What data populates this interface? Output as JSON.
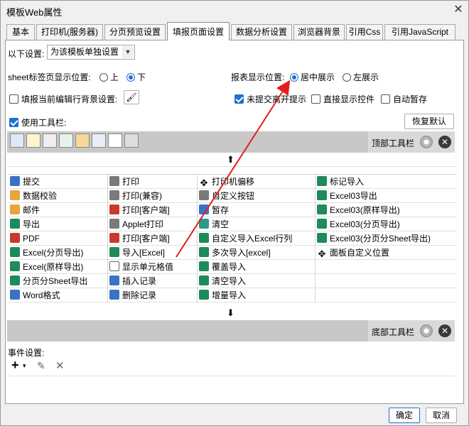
{
  "window": {
    "title": "模板Web属性",
    "close_glyph": "✕"
  },
  "tabs": [
    {
      "label": "基本"
    },
    {
      "label": "打印机(服务器)"
    },
    {
      "label": "分页预览设置"
    },
    {
      "label": "填报页面设置"
    },
    {
      "label": "数据分析设置"
    },
    {
      "label": "浏览器背景"
    },
    {
      "label": "引用Css"
    },
    {
      "label": "引用JavaScript"
    }
  ],
  "settings": {
    "scope_label": "以下设置:",
    "scope_value": "为该模板单独设置",
    "sheet_pos_label": "sheet标签页显示位置:",
    "sheet_pos_options": [
      "上",
      "下"
    ],
    "sheet_pos_selected": "下",
    "report_pos_label": "报表显示位置:",
    "report_pos_options": [
      "居中展示",
      "左展示"
    ],
    "report_pos_selected": "居中展示",
    "fill_bg_label": "填报当前编辑行背景设置:",
    "unsubmitted_label": "未提交离开提示",
    "direct_ctrl_label": "直接显示控件",
    "autosave_label": "自动暂存",
    "use_toolbar_label": "使用工具栏:",
    "restore_default": "恢复默认"
  },
  "top_toolbar": {
    "label": "顶部工具栏"
  },
  "bottom_toolbar": {
    "label": "底部工具栏"
  },
  "buttons_grid": {
    "col1": [
      {
        "label": "提交",
        "icon": "submit-icon"
      },
      {
        "label": "数据校验",
        "icon": "verify-icon"
      },
      {
        "label": "邮件",
        "icon": "mail-icon"
      },
      {
        "label": "导出",
        "icon": "export-icon"
      },
      {
        "label": "PDF",
        "icon": "pdf-icon"
      },
      {
        "label": "Excel(分页导出)",
        "icon": "excel-icon"
      },
      {
        "label": "Excel(原样导出)",
        "icon": "excel-icon"
      },
      {
        "label": "分页分Sheet导出",
        "icon": "excel-icon"
      },
      {
        "label": "Word格式",
        "icon": "word-icon"
      }
    ],
    "col2": [
      {
        "label": "打印",
        "icon": "print-icon"
      },
      {
        "label": "打印(兼容)",
        "icon": "print-icon"
      },
      {
        "label": "打印[客户端]",
        "icon": "print-client-icon"
      },
      {
        "label": "Applet打印",
        "icon": "applet-print-icon"
      },
      {
        "label": "打印[客户端]",
        "icon": "print-client-icon"
      },
      {
        "label": "导入[Excel]",
        "icon": "import-excel-icon"
      },
      {
        "label": "显示单元格值",
        "icon": "cell-value-icon"
      },
      {
        "label": "插入记录",
        "icon": "insert-record-icon"
      },
      {
        "label": "删除记录",
        "icon": "delete-record-icon"
      }
    ],
    "col3": [
      {
        "label": "打印机偏移",
        "icon": "offset-icon"
      },
      {
        "label": "自定义按钮",
        "icon": "gear-icon"
      },
      {
        "label": "暂存",
        "icon": "save-temp-icon"
      },
      {
        "label": "清空",
        "icon": "clear-icon"
      },
      {
        "label": "自定义导入Excel行列",
        "icon": "excel-icon"
      },
      {
        "label": "多次导入[excel]",
        "icon": "excel-icon"
      },
      {
        "label": "覆盖导入",
        "icon": "excel-icon"
      },
      {
        "label": "清空导入",
        "icon": "excel-icon"
      },
      {
        "label": "增量导入",
        "icon": "excel-icon"
      }
    ],
    "col4": [
      {
        "label": "标记导入",
        "icon": "mark-import-icon"
      },
      {
        "label": "Excel03导出",
        "icon": "excel-icon"
      },
      {
        "label": "Excel03(原样导出)",
        "icon": "excel-icon"
      },
      {
        "label": "Excel03(分页导出)",
        "icon": "excel-icon"
      },
      {
        "label": "Excel03(分页分Sheet导出)",
        "icon": "excel-icon"
      },
      {
        "label": "面板自定义位置",
        "icon": "move-icon"
      },
      {
        "label": "",
        "icon": ""
      },
      {
        "label": "",
        "icon": ""
      },
      {
        "label": "",
        "icon": ""
      }
    ]
  },
  "events": {
    "label": "事件设置:"
  },
  "footer": {
    "ok": "确定",
    "cancel": "取消"
  },
  "colors": {
    "accent": "#1f6fd1",
    "annotation": "#e02020"
  }
}
